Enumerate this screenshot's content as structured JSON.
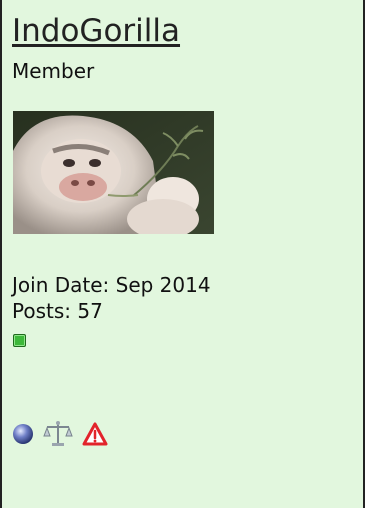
{
  "user": {
    "username": "IndoGorilla",
    "title": "Member"
  },
  "avatar": {
    "alt": "IndoGorilla"
  },
  "stats": {
    "join_label": "Join Date:",
    "join_value": "Sep 2014",
    "posts_label": "Posts:",
    "posts_value": "57"
  },
  "status": {
    "online_color": "#3db83a",
    "tooltip": "IndoGorilla is online now"
  },
  "icons": [
    {
      "name": "reputation-orb-icon"
    },
    {
      "name": "scales-icon"
    },
    {
      "name": "warning-triangle-icon"
    }
  ],
  "colors": {
    "panel_bg": "#e2f7de",
    "border": "#222222",
    "text": "#111111"
  }
}
